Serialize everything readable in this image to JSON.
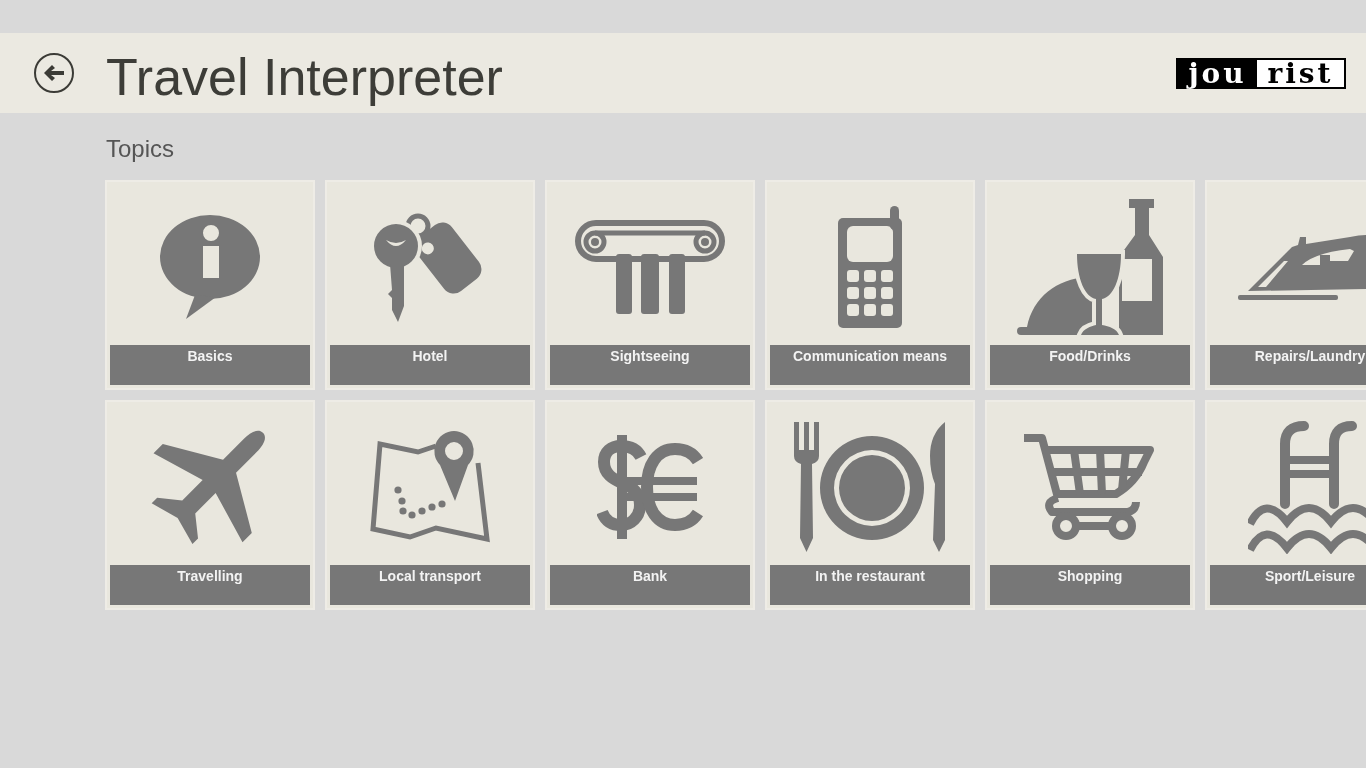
{
  "header": {
    "title": "Travel Interpreter",
    "logo": [
      {
        "text": "jou",
        "inverted": true
      },
      {
        "text": "rist",
        "inverted": false
      }
    ]
  },
  "section": {
    "heading": "Topics"
  },
  "topics": [
    {
      "label": "Basics",
      "kind": "info"
    },
    {
      "label": "Hotel",
      "kind": "keys"
    },
    {
      "label": "Sightseeing",
      "kind": "column"
    },
    {
      "label": "Communication means",
      "kind": "phone"
    },
    {
      "label": "Food/Drinks",
      "kind": "dining"
    },
    {
      "label": "Repairs/Laundry",
      "kind": "iron"
    },
    {
      "label": "Travelling",
      "kind": "plane"
    },
    {
      "label": "Local transport",
      "kind": "map"
    },
    {
      "label": "Bank",
      "kind": "currency"
    },
    {
      "label": "In the restaurant",
      "kind": "tableware"
    },
    {
      "label": "Shopping",
      "kind": "cart"
    },
    {
      "label": "Sport/Leisure",
      "kind": "pool"
    }
  ]
}
